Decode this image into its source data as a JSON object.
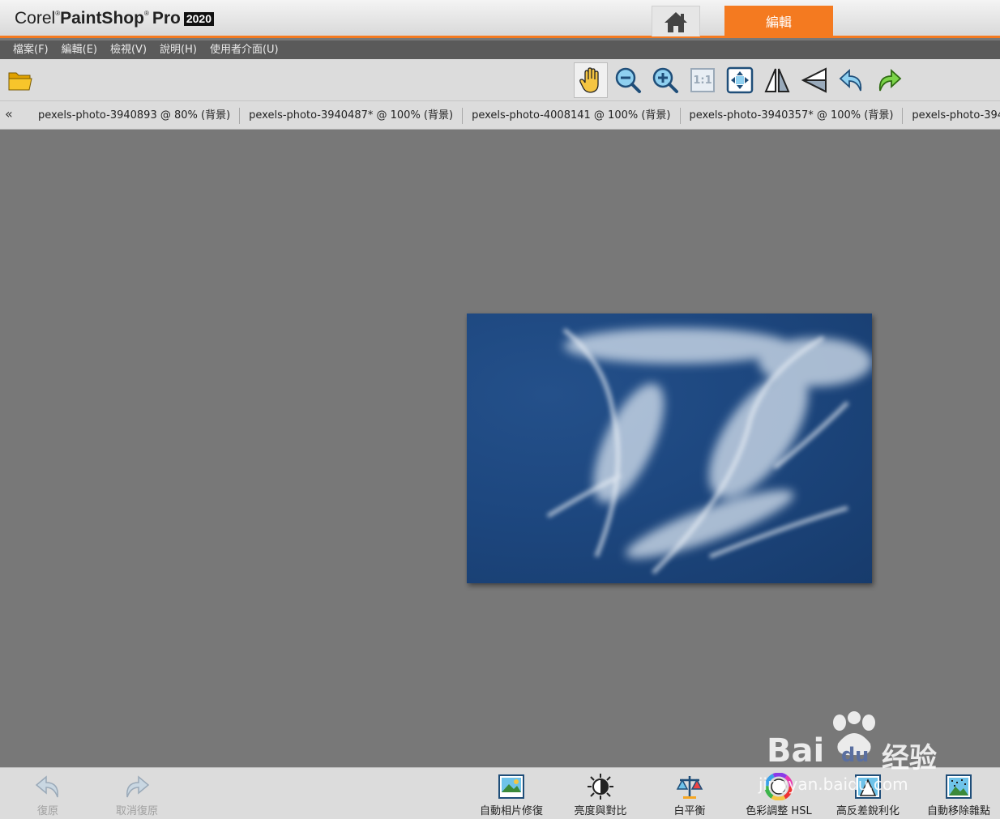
{
  "app": {
    "brand_corel": "Corel",
    "brand_paintshop": "PaintShop",
    "brand_pro": "Pro",
    "brand_reg": "®",
    "brand_year": "2020",
    "edit_tab_label": "編輯",
    "accent_color": "#f47a20"
  },
  "menu": {
    "items": [
      "檔案(F)",
      "編輯(E)",
      "檢視(V)",
      "說明(H)",
      "使用者介面(U)"
    ]
  },
  "toolbar": {
    "icons": [
      "open-folder-icon",
      "pan-hand-icon",
      "zoom-out-icon",
      "zoom-in-icon",
      "actual-size-icon",
      "fit-window-icon",
      "flip-horizontal-icon",
      "flip-vertical-icon",
      "rotate-left-icon",
      "rotate-right-icon"
    ],
    "actual_size_label": "1:1"
  },
  "tabs": {
    "arrow": "«",
    "items": [
      "pexels-photo-3940893 @  80% (背景)",
      "pexels-photo-3940487* @ 100% (背景)",
      "pexels-photo-4008141 @ 100% (背景)",
      "pexels-photo-3940357* @ 100% (背景)",
      "pexels-photo-3940"
    ]
  },
  "bottom": {
    "undo_label": "復原",
    "redo_label": "取消復原",
    "tools": [
      "自動相片修復",
      "亮度與對比",
      "白平衡",
      "色彩調整 HSL",
      "高反差銳利化",
      "自動移除雜點"
    ]
  },
  "watermark": {
    "brand": "Bai",
    "du": "du",
    "cn": "经验",
    "url": "jingyan.baidu.com"
  }
}
